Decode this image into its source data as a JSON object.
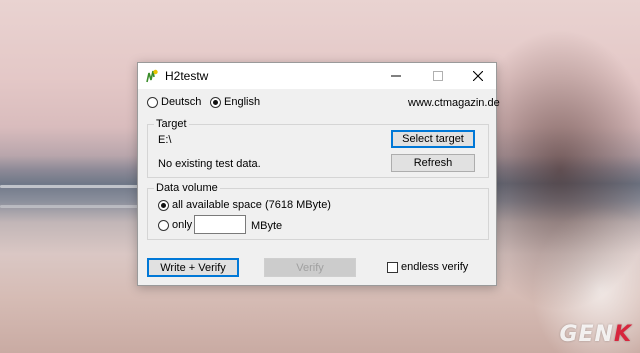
{
  "window": {
    "title": "H2testw",
    "controls": {
      "minimize": "minimize",
      "maximize": "maximize",
      "close": "close"
    }
  },
  "language": {
    "options": [
      {
        "label": "Deutsch",
        "selected": false
      },
      {
        "label": "English",
        "selected": true
      }
    ],
    "website": "www.ctmagazin.de"
  },
  "target": {
    "group_title": "Target",
    "path": "E:\\",
    "status": "No existing test data.",
    "select_button": "Select target",
    "refresh_button": "Refresh"
  },
  "data_volume": {
    "group_title": "Data volume",
    "all_option": "all available space (7618 MByte)",
    "only_option": "only",
    "only_value": "",
    "unit": "MByte"
  },
  "actions": {
    "write_verify": "Write + Verify",
    "verify": "Verify",
    "endless_verify": "endless verify",
    "endless_checked": false
  },
  "watermark": {
    "prefix": "GEN",
    "suffix": "K"
  },
  "colors": {
    "accent": "#0078d7",
    "window_bg": "#f0f0f0",
    "watermark_k": "#d7263d"
  }
}
